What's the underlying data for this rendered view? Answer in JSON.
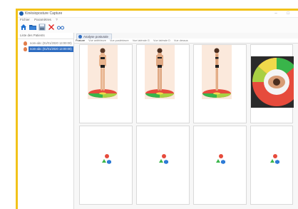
{
  "window": {
    "title": "Kinésioposture Capture",
    "controls": "– □"
  },
  "menu": [
    "Fichier",
    "Paramètres",
    "?"
  ],
  "toolbar": [
    {
      "name": "home-icon"
    },
    {
      "name": "open-folder-icon"
    },
    {
      "name": "save-icon"
    },
    {
      "name": "delete-icon"
    },
    {
      "name": "glasses-icon"
    }
  ],
  "sidebar": {
    "header": "Liste des Patients",
    "patients": [
      {
        "label": "nom-abc (01/01/2020 13:00:00)",
        "selected": false
      },
      {
        "label": "nom-abc (01/01/2020 13:00:00)",
        "selected": true
      }
    ]
  },
  "tab": {
    "label": "Analyse posturale"
  },
  "subtabs": [
    "Posture",
    "Vue antérieure",
    "Vue postérieure",
    "Vue latérale G",
    "Vue latérale D",
    "Vue dessus"
  ],
  "grid": {
    "photos": [
      {
        "name": "front-view-photo"
      },
      {
        "name": "back-view-photo"
      },
      {
        "name": "side-view-photo"
      },
      {
        "name": "top-view-photo"
      }
    ],
    "placeholders": 4
  }
}
